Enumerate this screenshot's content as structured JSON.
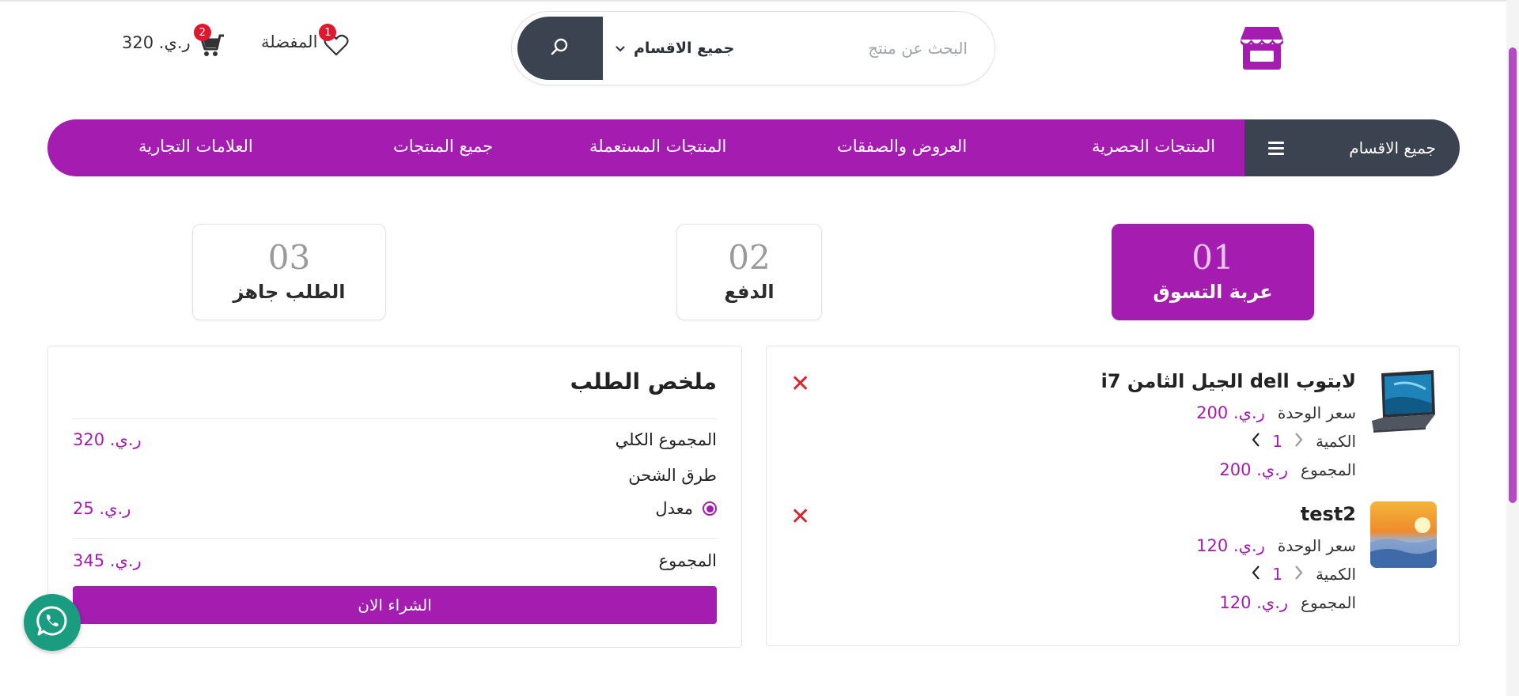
{
  "header": {
    "search_placeholder": "البحث عن منتج",
    "category_select": "جميع الاقسام",
    "favorites_label": "المفضلة",
    "favorites_count": "1",
    "cart_count": "2",
    "cart_total": "ر.ي. 320"
  },
  "nav": {
    "all_categories": "جميع الاقسام",
    "items": [
      "المنتجات الحصرية",
      "العروض والصفقات",
      "المنتجات المستعملة",
      "جميع المنتجات",
      "العلامات التجارية"
    ]
  },
  "steps": [
    {
      "num": "01",
      "title": "عربة التسوق"
    },
    {
      "num": "02",
      "title": "الدفع"
    },
    {
      "num": "03",
      "title": "الطلب جاهز"
    }
  ],
  "cart": {
    "unit_price_label": "سعر الوحدة",
    "quantity_label": "الكمية",
    "total_label": "المجموع",
    "items": [
      {
        "name": "لابتوب dell الجيل الثامن i7",
        "unit_price": "ر.ي. 200",
        "quantity": "1",
        "total": "ر.ي. 200"
      },
      {
        "name": "test2",
        "unit_price": "ر.ي. 120",
        "quantity": "1",
        "total": "ر.ي. 120"
      }
    ]
  },
  "summary": {
    "title": "ملخص الطلب",
    "subtotal_label": "المجموع الكلي",
    "subtotal_value": "ر.ي. 320",
    "shipping_label": "طرق الشحن",
    "shipping_option": "معدل",
    "shipping_value": "ر.ي. 25",
    "total_label": "المجموع",
    "total_value": "ر.ي. 345",
    "buy_button": "الشراء الان"
  },
  "colors": {
    "brand": "#a41db0",
    "dark": "#3b4250",
    "danger": "#d9262b",
    "whatsapp": "#1a9c80"
  }
}
